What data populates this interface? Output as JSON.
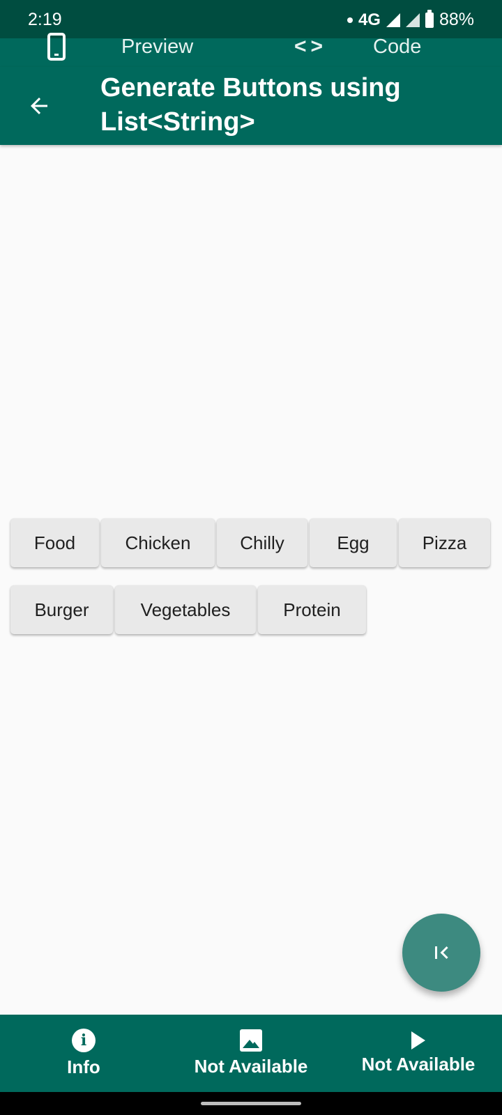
{
  "status_bar": {
    "time": "2:19",
    "network": "4G",
    "battery": "88%"
  },
  "tabs": {
    "preview_label": "Preview",
    "code_label": "Code"
  },
  "app_bar": {
    "title": "Generate Buttons using List<String>"
  },
  "buttons": {
    "row1": [
      "Food",
      "Chicken",
      "Chilly",
      "Egg",
      "Pizza"
    ],
    "row2": [
      "Burger",
      "Vegetables",
      "Protein"
    ]
  },
  "fab": {
    "icon": "first-page-icon"
  },
  "bottom_nav": {
    "items": [
      {
        "label": "Info",
        "icon": "info-icon"
      },
      {
        "label": "Not Available",
        "icon": "image-icon"
      },
      {
        "label": "Not Available",
        "icon": "play-icon"
      }
    ]
  },
  "colors": {
    "primary": "#00695c",
    "status_bar": "#004d40",
    "fab": "#3d8a80",
    "button_bg": "#e9e9e9",
    "background": "#fafafa"
  }
}
